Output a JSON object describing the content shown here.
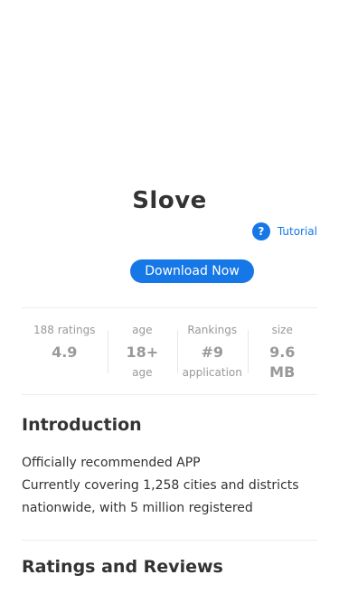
{
  "app": {
    "name": "Slove"
  },
  "tutorial": {
    "icon": "?",
    "label": "Tutorial"
  },
  "download": {
    "label": "Download Now"
  },
  "stats": [
    {
      "label": "188 ratings",
      "value": "4.9",
      "sub": ""
    },
    {
      "label": "age",
      "value": "18+",
      "sub": "age"
    },
    {
      "label": "Rankings",
      "value": "#9",
      "sub": "application"
    },
    {
      "label": "size",
      "value": "9.6 MB",
      "sub": ""
    }
  ],
  "introduction": {
    "title": "Introduction",
    "lines": [
      "Officially recommended APP",
      "Currently covering 1,258 cities and districts nationwide, with 5 million registered"
    ]
  },
  "reviews": {
    "title": "Ratings and Reviews"
  },
  "colors": {
    "accent": "#1677e6",
    "text": "#333333",
    "muted": "#999999"
  }
}
